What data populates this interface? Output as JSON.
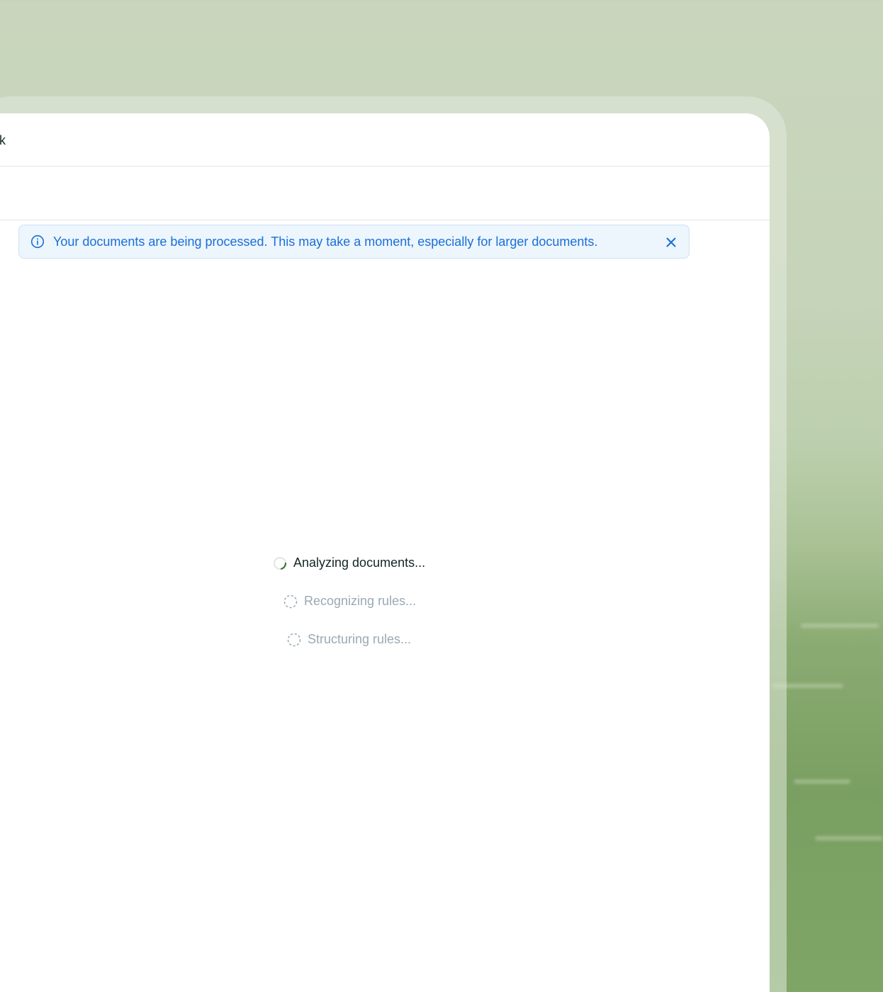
{
  "window": {
    "title": "ybook"
  },
  "banner": {
    "message": "Your documents are being processed. This may take a moment, especially for larger documents.",
    "info_icon": "info-circle-icon",
    "close_icon": "close-icon",
    "color": "#1a6fd6"
  },
  "steps": [
    {
      "label": "Analyzing documents...",
      "status": "active",
      "icon": "spinner-icon"
    },
    {
      "label": "Recognizing rules...",
      "status": "pending",
      "icon": "dashed-circle-icon"
    },
    {
      "label": "Structuring rules...",
      "status": "pending",
      "icon": "dashed-circle-icon"
    }
  ],
  "colors": {
    "accent_green": "#3f7a3a",
    "pending_gray": "#9aa9b4",
    "border": "#dde6ec"
  }
}
